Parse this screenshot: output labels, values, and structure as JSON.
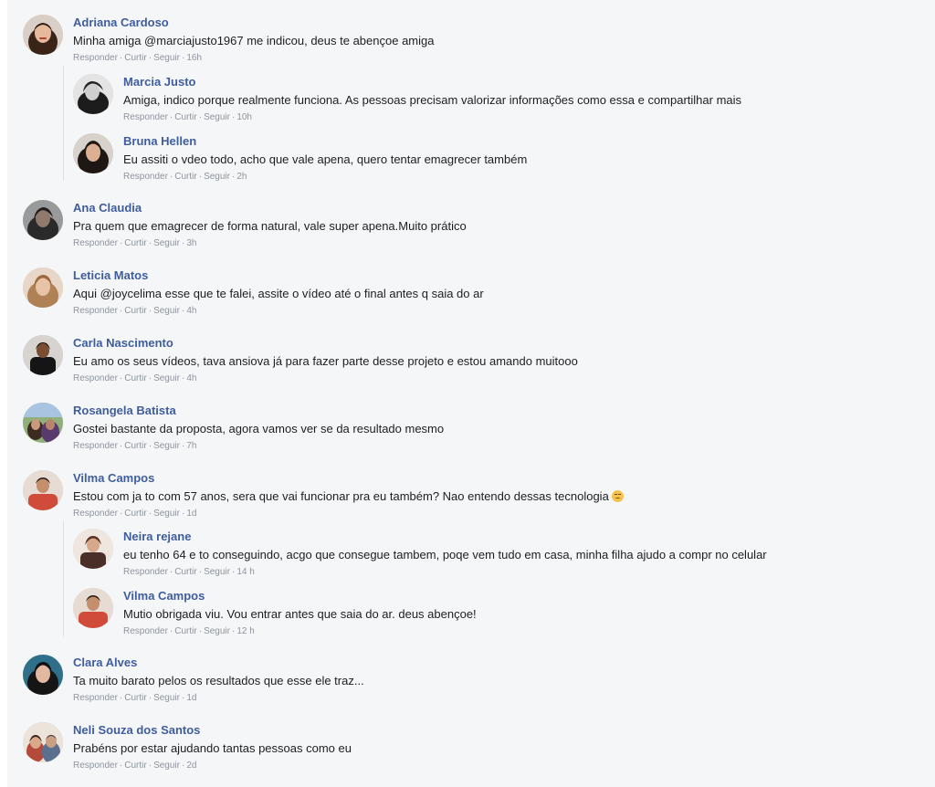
{
  "actions": {
    "reply": "Responder",
    "like": "Curtir",
    "follow": "Seguir",
    "separator": "·"
  },
  "comments": [
    {
      "name": "Adriana Cardoso",
      "text": "Minha amiga @marciajusto1967 me indicou, deus te abençoe amiga",
      "time": "16h",
      "replies": [
        {
          "name": "Marcia Justo",
          "text": "Amiga, indico porque realmente funciona. As pessoas precisam valorizar informações como essa e compartilhar mais",
          "time": "10h"
        },
        {
          "name": "Bruna Hellen",
          "text": "Eu assiti o vdeo todo, acho que vale apena, quero tentar emagrecer também",
          "time": "2h"
        }
      ]
    },
    {
      "name": "Ana Claudia",
      "text": "Pra quem que emagrecer de forma natural, vale super apena.Muito prático",
      "time": "3h"
    },
    {
      "name": "Leticia Matos",
      "text": "Aqui @joycelima esse que te falei, assite o vídeo até o final antes q saia do ar",
      "time": "4h"
    },
    {
      "name": "Carla Nascimento",
      "text": "Eu amo os seus vídeos, tava ansiova já para fazer parte desse projeto e estou amando muitooo",
      "time": "4h"
    },
    {
      "name": "Rosangela Batista",
      "text": "Gostei bastante da proposta, agora vamos ver se da resultado mesmo",
      "time": "7h"
    },
    {
      "name": "Vilma Campos",
      "text": "Estou com ja to com 57 anos, sera que vai funcionar pra eu também? Nao entendo dessas tecnologia",
      "emoji": "disappointed-face-icon",
      "time": "1d",
      "replies": [
        {
          "name": "Neira rejane",
          "text": "eu tenho 64 e to conseguindo, acgo que consegue tambem, poqe vem tudo em casa, minha filha ajudo a compr no celular",
          "time": "14 h"
        },
        {
          "name": "Vilma Campos",
          "text": "Mutio obrigada viu. Vou entrar antes que saia do ar. deus abençoe!",
          "time": "12 h"
        }
      ]
    },
    {
      "name": "Clara Alves",
      "text": "Ta muito barato pelos os resultados que esse ele traz...",
      "time": "1d"
    },
    {
      "name": "Neli Souza dos Santos",
      "text": "Prabéns por estar ajudando tantas pessoas como eu",
      "time": "2d"
    }
  ]
}
